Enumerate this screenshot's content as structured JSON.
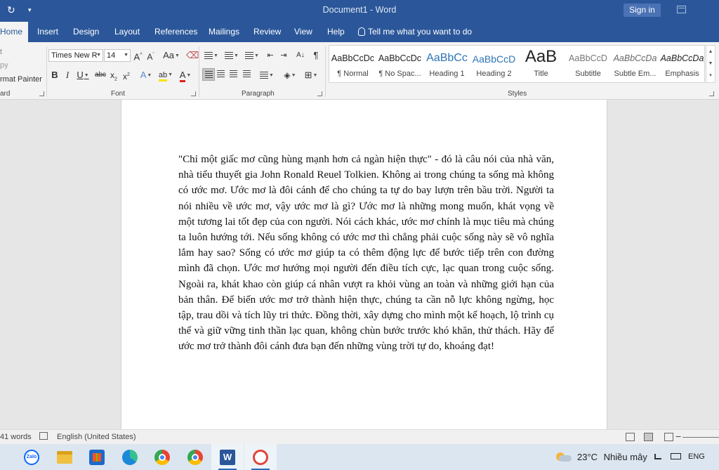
{
  "title_bar": {
    "document_title": "Document1  -  Word",
    "sign_in_label": "Sign in"
  },
  "tabs": [
    {
      "label": "Home",
      "active": true
    },
    {
      "label": "Insert"
    },
    {
      "label": "Design"
    },
    {
      "label": "Layout"
    },
    {
      "label": "References"
    },
    {
      "label": "Mailings"
    },
    {
      "label": "Review"
    },
    {
      "label": "View"
    },
    {
      "label": "Help"
    }
  ],
  "tell_me": "Tell me what you want to do",
  "ribbon": {
    "clipboard": {
      "copy_label": "py",
      "format_painter_label": "rmat Painter",
      "group_label": "ard"
    },
    "font": {
      "font_name": "Times New R",
      "font_size": "14",
      "change_case_label": "Aa",
      "group_label": "Font"
    },
    "paragraph": {
      "group_label": "Paragraph"
    },
    "styles": {
      "group_label": "Styles",
      "items": [
        {
          "preview": "AaBbCcDc",
          "name": "¶ Normal"
        },
        {
          "preview": "AaBbCcDc",
          "name": "¶ No Spac..."
        },
        {
          "preview": "AaBbCc",
          "name": "Heading 1"
        },
        {
          "preview": "AaBbCcD",
          "name": "Heading 2"
        },
        {
          "preview": "AaB",
          "name": "Title"
        },
        {
          "preview": "AaBbCcD",
          "name": "Subtitle"
        },
        {
          "preview": "AaBbCcDa",
          "name": "Subtle Em..."
        },
        {
          "preview": "AaBbCcDa",
          "name": "Emphasis"
        }
      ]
    }
  },
  "document": {
    "text": "\"Chỉ một giấc mơ cũng hùng mạnh hơn cả ngàn hiện thực\" - đó là câu nói của nhà văn, nhà tiểu thuyết gia John Ronald Reuel Tolkien. Không ai trong chúng ta sống mà không có ước mơ. Ước mơ là đôi cánh để cho chúng ta tự do bay lượn trên bầu trời. Người ta nói nhiều về ước mơ, vậy ước mơ là gì? Ước mơ là những mong muốn, khát vọng về một tương lai tốt đẹp của con người. Nói cách khác, ước mơ chính là mục tiêu mà chúng ta luôn hướng tới. Nếu sống không có ước mơ thì chẳng phải cuộc sống này sẽ vô nghĩa lắm hay sao? Sống có ước mơ giúp ta có thêm động lực để bước tiếp trên con đường mình đã chọn. Ước mơ hướng mọi người đến điều tích cực, lạc quan trong cuộc sống. Ngoài ra, khát khao còn giúp cá nhân vượt ra khỏi vùng an toàn và những giới hạn của bản thân. Để biến ước mơ trở thành hiện thực, chúng ta cần nỗ lực không ngừng, học tập, trau dồi và tích lũy tri thức. Đồng thời, xây dựng cho mình một kế hoạch, lộ trình cụ thể và giữ vững tinh thần lạc quan, không chùn bước trước khó khăn, thử thách. Hãy để ước mơ trở thành đôi cánh đưa bạn đến những vùng trời tự do, khoáng đạt!"
  },
  "status_bar": {
    "word_count": "41 words",
    "language": "English (United States)"
  },
  "taskbar": {
    "apps": [
      "zalo-icon",
      "file-explorer-icon",
      "store-icon",
      "edge-icon",
      "chrome-icon",
      "chrome-profile-icon",
      "word-icon",
      "snipping-tool-icon"
    ],
    "weather_temp": "23°C",
    "weather_desc": "Nhiều mây",
    "language": "ENG",
    "accent_color": "#2b579a"
  }
}
